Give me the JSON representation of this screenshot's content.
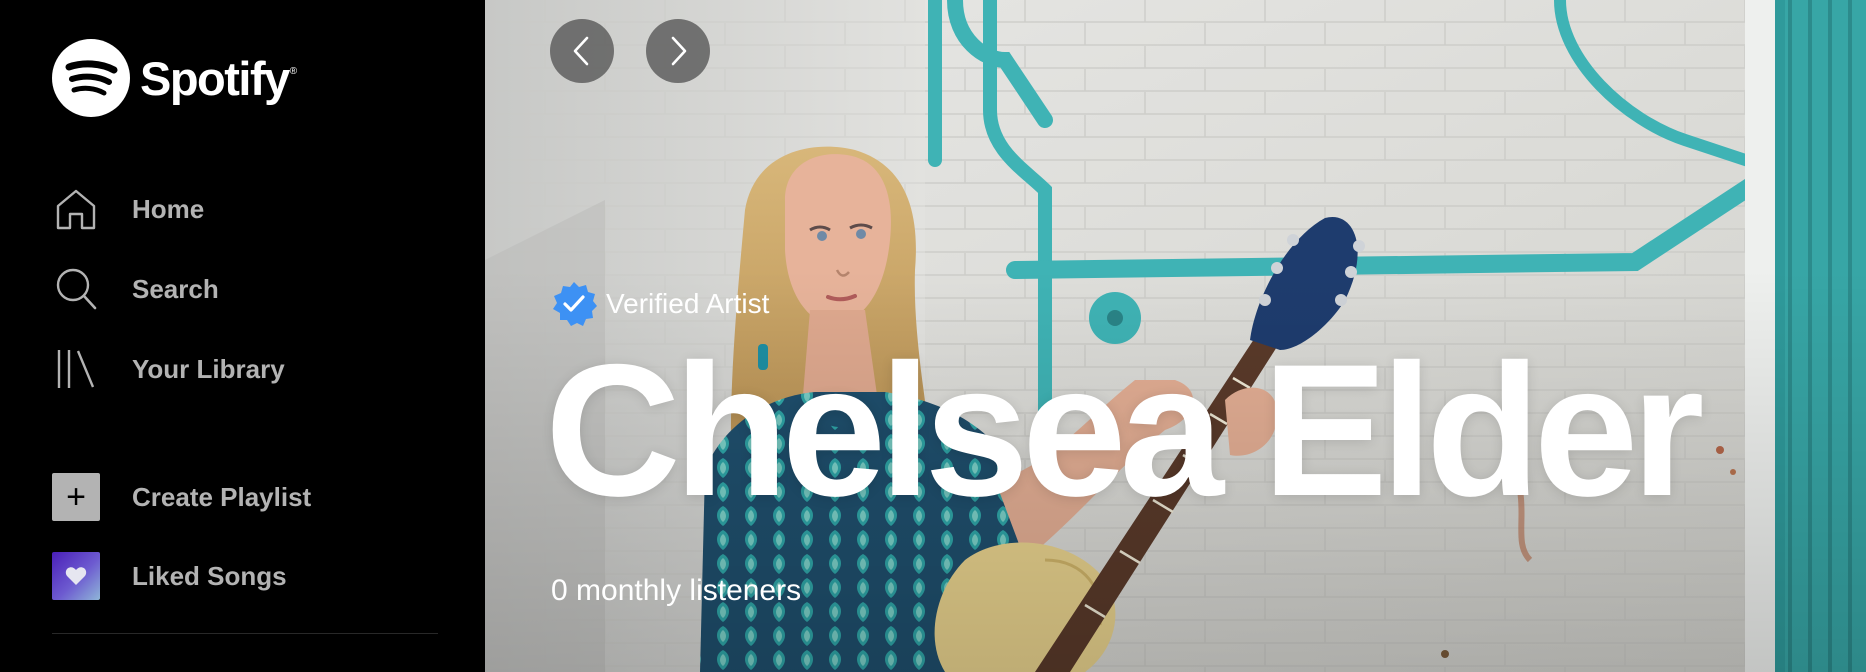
{
  "app": {
    "brand": "Spotify"
  },
  "sidebar": {
    "nav": [
      {
        "label": "Home",
        "icon": "home-icon"
      },
      {
        "label": "Search",
        "icon": "search-icon"
      },
      {
        "label": "Your Library",
        "icon": "library-icon"
      }
    ],
    "actions": [
      {
        "label": "Create Playlist",
        "icon": "plus-icon"
      },
      {
        "label": "Liked Songs",
        "icon": "heart-icon"
      }
    ]
  },
  "header": {
    "back_icon": "chevron-left-icon",
    "forward_icon": "chevron-right-icon"
  },
  "artist": {
    "verified_label": "Verified Artist",
    "name": "Chelsea Elder",
    "monthly_listeners": "0 monthly listeners"
  },
  "colors": {
    "background": "#000000",
    "sidebar_text": "#b3b3b3",
    "verified_badge": "#3d91f4",
    "pipe_teal": "#3fb3b5"
  }
}
